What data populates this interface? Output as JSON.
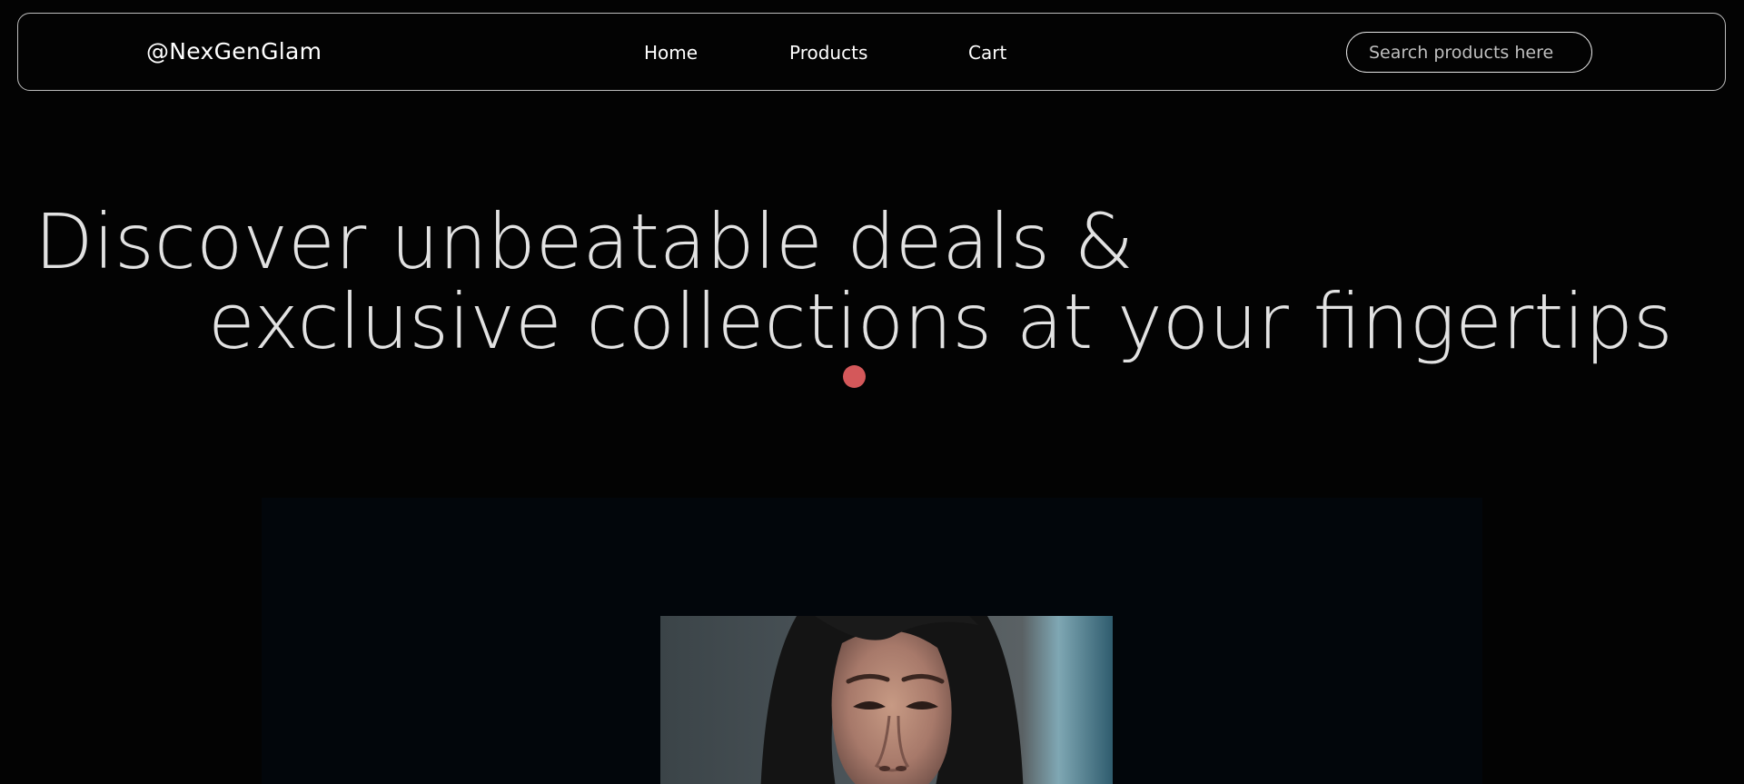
{
  "navbar": {
    "brand": "@NexGenGlam",
    "links": [
      {
        "label": "Home"
      },
      {
        "label": "Products"
      },
      {
        "label": "Cart"
      }
    ],
    "search": {
      "placeholder": "Search products here",
      "value": ""
    }
  },
  "hero": {
    "line1": "Discover unbeatable deals &",
    "line2": "exclusive collections at your fingertips"
  },
  "colors": {
    "background": "#030303",
    "text": "#e2e2e2",
    "accent_dot": "#d4585a",
    "panel": "#02060b"
  }
}
